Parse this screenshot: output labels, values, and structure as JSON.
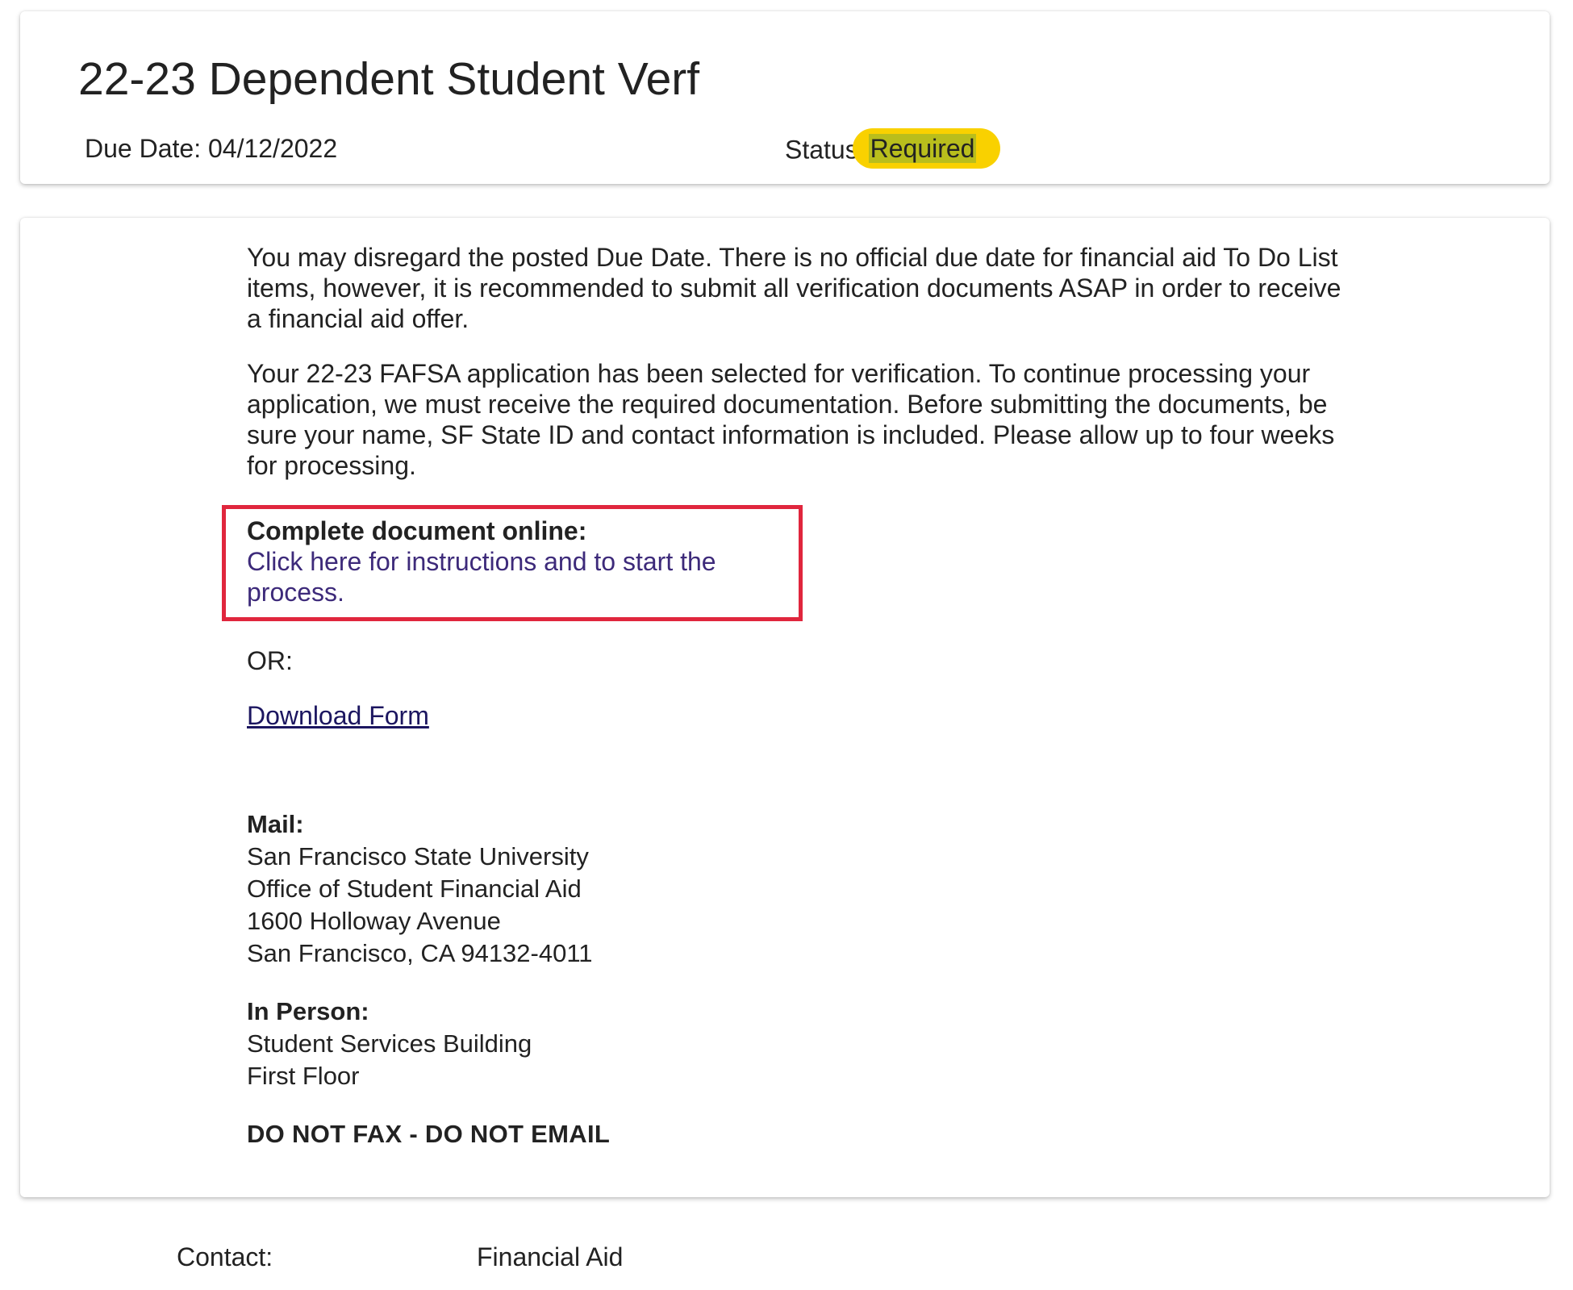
{
  "header": {
    "title": "22-23 Dependent Student Verf",
    "due_date": "Due Date: 04/12/2022",
    "status_label": "Status:",
    "status_value": "Required",
    "status_color": "#f9d100"
  },
  "body": {
    "paragraph_1": "You may disregard the posted Due Date. There is no official due date for financial aid To Do List items, however, it is recommended to submit all verification documents ASAP in order to receive a financial aid offer.",
    "paragraph_2": "Your 22-23 FAFSA application has been selected for verification. To continue processing your application, we must receive the required documentation. Before submitting the documents, be sure your name, SF State ID and contact information is included. Please allow up to four weeks for processing.",
    "online": {
      "heading": "Complete document online:",
      "link_text": "Click here for instructions and to start the process.",
      "box_color": "#e0263d"
    },
    "or_text": "OR:",
    "download_link": "Download Form",
    "mail": {
      "heading": "Mail:",
      "lines": [
        "San Francisco State University",
        "Office of Student Financial Aid",
        "1600 Holloway Avenue",
        "San Francisco, CA 94132-4011"
      ]
    },
    "in_person": {
      "heading": "In Person:",
      "lines": [
        "Student Services Building",
        "First Floor"
      ]
    },
    "warning": "DO NOT FAX - DO NOT EMAIL"
  },
  "footer": {
    "contact_label": "Contact:",
    "contact_value": "Financial Aid"
  }
}
